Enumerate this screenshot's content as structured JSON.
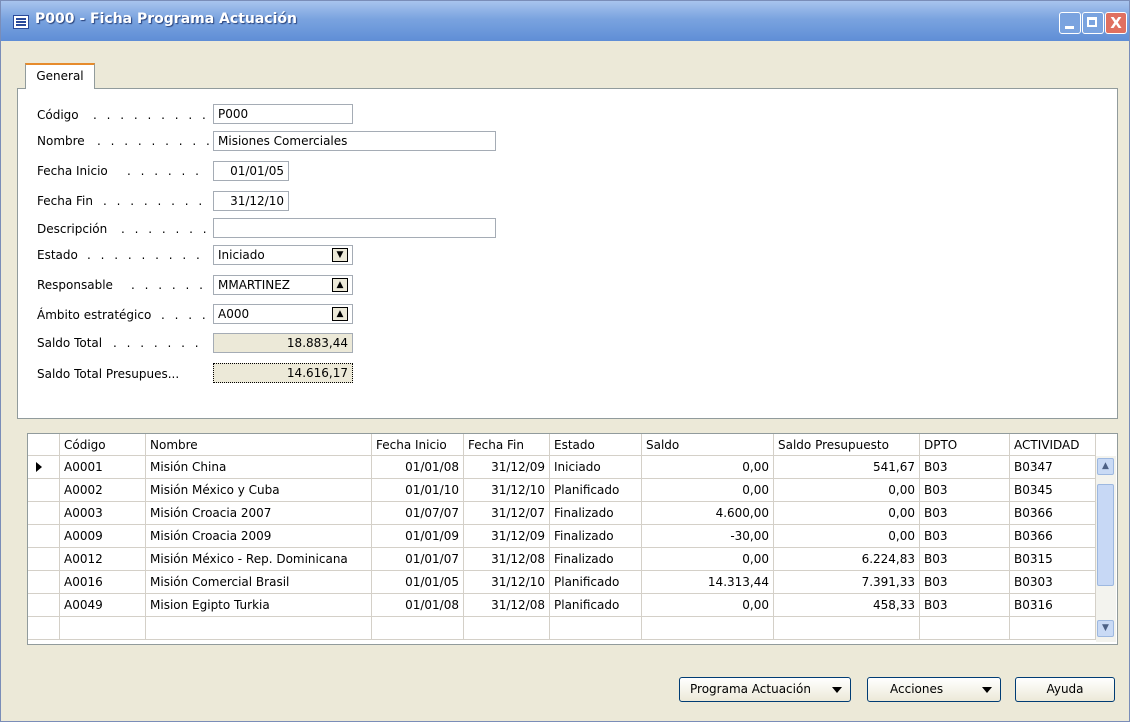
{
  "window": {
    "title": "P000 - Ficha Programa Actuación",
    "close_symbol": "X"
  },
  "tabs": [
    {
      "label": "General"
    }
  ],
  "form": {
    "codigo": {
      "label": "Código",
      "value": "P000"
    },
    "nombre": {
      "label": "Nombre",
      "value": "Misiones Comerciales"
    },
    "fecha_inicio": {
      "label": "Fecha Inicio",
      "value": "01/01/05"
    },
    "fecha_fin": {
      "label": "Fecha Fin",
      "value": "31/12/10"
    },
    "descripcion": {
      "label": "Descripción",
      "value": ""
    },
    "estado": {
      "label": "Estado",
      "value": "Iniciado"
    },
    "responsable": {
      "label": "Responsable",
      "value": "MMARTINEZ"
    },
    "ambito": {
      "label": "Ámbito estratégico",
      "value": "A000"
    },
    "saldo_total": {
      "label": "Saldo Total",
      "value": "18.883,44"
    },
    "saldo_total_presupuesto": {
      "label": "Saldo Total Presupues...",
      "value": "14.616,17"
    }
  },
  "grid": {
    "columns": [
      "Código",
      "Nombre",
      "Fecha Inicio",
      "Fecha Fin",
      "Estado",
      "Saldo",
      "Saldo Presupuesto",
      "DPTO",
      "ACTIVIDAD"
    ],
    "rows": [
      [
        "A0001",
        "Misión China",
        "01/01/08",
        "31/12/09",
        "Iniciado",
        "0,00",
        "541,67",
        "B03",
        "B0347"
      ],
      [
        "A0002",
        "Misión México y Cuba",
        "01/01/10",
        "31/12/10",
        "Planificado",
        "0,00",
        "0,00",
        "B03",
        "B0345"
      ],
      [
        "A0003",
        "Misión Croacia 2007",
        "01/07/07",
        "31/12/07",
        "Finalizado",
        "4.600,00",
        "0,00",
        "B03",
        "B0366"
      ],
      [
        "A0009",
        "Misión Croacia 2009",
        "01/01/09",
        "31/12/09",
        "Finalizado",
        "-30,00",
        "0,00",
        "B03",
        "B0366"
      ],
      [
        "A0012",
        "Misión México - Rep. Dominicana",
        "01/01/07",
        "31/12/08",
        "Finalizado",
        "0,00",
        "6.224,83",
        "B03",
        "B0315"
      ],
      [
        "A0016",
        "Misión Comercial Brasil",
        "01/01/05",
        "31/12/10",
        "Planificado",
        "14.313,44",
        "7.391,33",
        "B03",
        "B0303"
      ],
      [
        "A0049",
        "Mision Egipto Turkia",
        "01/01/08",
        "31/12/08",
        "Planificado",
        "0,00",
        "458,33",
        "B03",
        "B0316"
      ],
      [
        "",
        "",
        "",
        "",
        "",
        "",
        "",
        "",
        ""
      ]
    ]
  },
  "buttons": {
    "programa": "Programa Actuación",
    "acciones": "Acciones",
    "ayuda": "Ayuda"
  },
  "colors": {
    "titlebar": "#7aa3df",
    "window_bg": "#ECE9D8",
    "tab_accent": "#E68B2C",
    "close_button": "#e07060"
  },
  "icons": [
    "app-form-icon",
    "minimize-icon",
    "maximize-icon",
    "close-icon",
    "dropdown-arrow-icon",
    "lookup-arrow-icon",
    "row-pointer-icon",
    "scroll-up-icon",
    "scroll-down-icon"
  ]
}
